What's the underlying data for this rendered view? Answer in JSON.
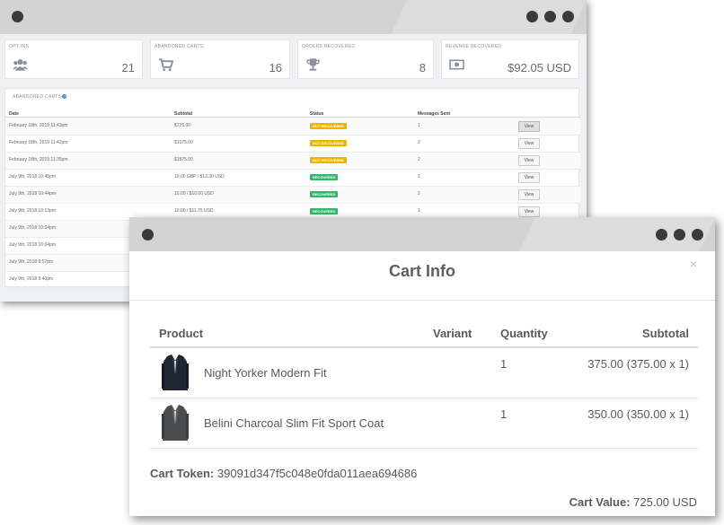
{
  "back_window": {
    "stats": [
      {
        "label": "OPT-INS",
        "value": "21",
        "icon": "users-icon"
      },
      {
        "label": "ABANDONED CARTS",
        "value": "16",
        "icon": "cart-icon"
      },
      {
        "label": "ORDERS RECOVERED",
        "value": "8",
        "icon": "trophy-icon"
      },
      {
        "label": "REVENUE RECOVERED",
        "value": "$92.05 USD",
        "icon": "money-icon"
      }
    ],
    "panel_title": "ABANDONED CARTS",
    "info_glyph": "?",
    "columns": [
      "Date",
      "Subtotal",
      "Status",
      "Messages Sent"
    ],
    "view_label": "View",
    "rows": [
      {
        "date": "February 18th, 2019 11:43pm",
        "subtotal": "$725.00",
        "status": "NOT RECOVERED",
        "status_type": "not",
        "messages": "1"
      },
      {
        "date": "February 18th, 2019 11:42pm",
        "subtotal": "$1075.00",
        "status": "NOT RECOVERED",
        "status_type": "not",
        "messages": "2"
      },
      {
        "date": "February 18th, 2019 11:35pm",
        "subtotal": "$1875.00",
        "status": "NOT RECOVERED",
        "status_type": "not",
        "messages": "2"
      },
      {
        "date": "July 9th, 2018 10:45pm",
        "subtotal": "10.00 GBP / $13.30 USD",
        "status": "RECOVERED",
        "status_type": "rec",
        "messages": "2"
      },
      {
        "date": "July 9th, 2018 10:44pm",
        "subtotal": "10.00 / $10.00 USD",
        "status": "RECOVERED",
        "status_type": "rec",
        "messages": "2"
      },
      {
        "date": "July 9th, 2018 10:13pm",
        "subtotal": "10.00 / $11.75 USD",
        "status": "RECOVERED",
        "status_type": "rec",
        "messages": "1"
      },
      {
        "date": "July 9th, 2018 10:04pm",
        "subtotal": "",
        "status": "",
        "status_type": "",
        "messages": ""
      },
      {
        "date": "July 9th, 2018 10:04pm",
        "subtotal": "",
        "status": "",
        "status_type": "",
        "messages": ""
      },
      {
        "date": "July 9th, 2018 9:57pm",
        "subtotal": "",
        "status": "",
        "status_type": "",
        "messages": ""
      },
      {
        "date": "July 9th, 2018 9:40pm",
        "subtotal": "",
        "status": "",
        "status_type": "",
        "messages": ""
      }
    ]
  },
  "modal": {
    "title": "Cart Info",
    "close_glyph": "×",
    "columns": {
      "product": "Product",
      "variant": "Variant",
      "quantity": "Quantity",
      "subtotal": "Subtotal"
    },
    "items": [
      {
        "name": "Night Yorker Modern Fit",
        "quantity": "1",
        "subtotal": "375.00 (375.00 x 1)",
        "thumb": "navy-suit-jacket"
      },
      {
        "name": "Belini Charcoal Slim Fit Sport Coat",
        "quantity": "1",
        "subtotal": "350.00 (350.00 x 1)",
        "thumb": "charcoal-sport-coat"
      }
    ],
    "token_label": "Cart Token:",
    "token_value": "39091d347f5c048e0fda011aea694686",
    "value_label": "Cart Value:",
    "value_value": "725.00 USD"
  },
  "colors": {
    "not_recovered": "#f0b400",
    "recovered": "#33b86a",
    "titlebar": "#d3d3d3"
  }
}
